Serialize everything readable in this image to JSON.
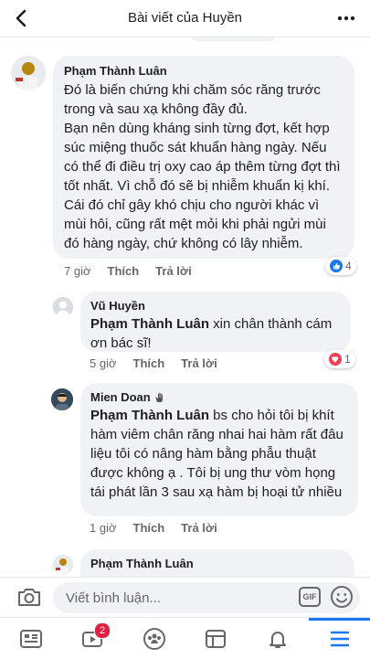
{
  "header": {
    "title": "Bài viết của Huyền",
    "back_icon": "chevron-left-icon",
    "more_icon": "more-horizontal-icon"
  },
  "comments": [
    {
      "author": "Phạm Thành Luân",
      "text": "Đó là biến chứng khi chăm sóc răng trước trong và sau xạ không đầy đủ.\nBạn nên dùng kháng sinh từng đợt, kết hợp súc miệng thuốc sát khuẩn hàng ngày. Nếu có thể đi điều trị oxy cao áp thêm từng đợt thì tốt nhất. Vì chỗ đó sẽ bị nhiễm khuẩn kị khí.\nCái đó chỉ gây khó chịu cho người khác vì mùi hôi, cũng rất mệt mỏi khi phải ngửi mùi đó hàng ngày, chứ không có lây nhiễm.",
      "time": "7 giờ",
      "like": "Thích",
      "reply": "Trả lời",
      "reaction_count": "4",
      "reaction_icon": "like-icon"
    },
    {
      "author": "Vũ Huyền",
      "mention": "Phạm Thành Luân",
      "text": " xin chân thành cám ơn bác sĩ!",
      "time": "5 giờ",
      "like": "Thích",
      "reply": "Trả lời",
      "reaction_count": "1",
      "reaction_icon": "love-icon"
    },
    {
      "author": "Mien Doan",
      "mention": "Phạm Thành Luân",
      "text": " bs cho hỏi tôi bị khít hàm viêm chân răng nhai hai hàm rất đâu liệu tôi có nâng hàm bằng phẫu thuật được không ạ . Tôi bị ung thư vòm họng tái phát lần 3 sau xạ hàm bị hoại tử nhiều",
      "time": "1 giờ",
      "like": "Thích",
      "reply": "Trả lời"
    },
    {
      "author": "Phạm Thành Luân"
    }
  ],
  "composer": {
    "placeholder": "Viết bình luận...",
    "gif": "GIF"
  },
  "tabbar": {
    "video_badge": "2"
  },
  "colors": {
    "accent": "#1877f2",
    "bubble": "#f0f2f5",
    "love": "#f33e58"
  }
}
